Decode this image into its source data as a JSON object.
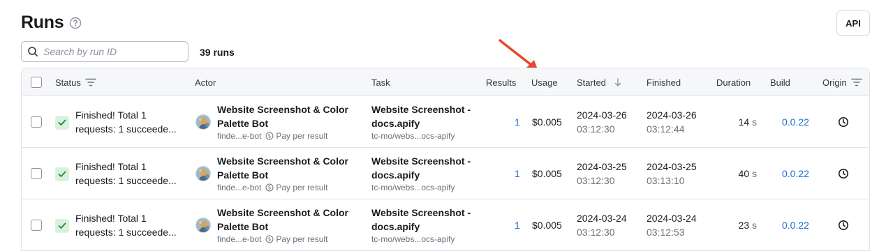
{
  "page": {
    "title": "Runs",
    "api_label": "API",
    "run_count": "39 runs"
  },
  "search": {
    "placeholder": "Search by run ID",
    "value": ""
  },
  "columns": {
    "status": "Status",
    "actor": "Actor",
    "task": "Task",
    "results": "Results",
    "usage": "Usage",
    "started": "Started",
    "finished": "Finished",
    "duration": "Duration",
    "build": "Build",
    "origin": "Origin"
  },
  "rows": [
    {
      "status_line1": "Finished! Total 1",
      "status_line2": "requests: 1 succeede...",
      "actor_line1": "Website Screenshot & Color",
      "actor_line2": "Palette Bot",
      "actor_id": "finde...e-bot",
      "pricing": "Pay per result",
      "task_line1": "Website Screenshot -",
      "task_line2": "docs.apify",
      "task_id": "tc-mo/webs...ocs-apify",
      "results": "1",
      "usage": "$0.005",
      "started_date": "2024-03-26",
      "started_time": "03:12:30",
      "finished_date": "2024-03-26",
      "finished_time": "03:12:44",
      "duration_value": "14",
      "duration_unit": "s",
      "build": "0.0.22"
    },
    {
      "status_line1": "Finished! Total 1",
      "status_line2": "requests: 1 succeede...",
      "actor_line1": "Website Screenshot & Color",
      "actor_line2": "Palette Bot",
      "actor_id": "finde...e-bot",
      "pricing": "Pay per result",
      "task_line1": "Website Screenshot -",
      "task_line2": "docs.apify",
      "task_id": "tc-mo/webs...ocs-apify",
      "results": "1",
      "usage": "$0.005",
      "started_date": "2024-03-25",
      "started_time": "03:12:30",
      "finished_date": "2024-03-25",
      "finished_time": "03:13:10",
      "duration_value": "40",
      "duration_unit": "s",
      "build": "0.0.22"
    },
    {
      "status_line1": "Finished! Total 1",
      "status_line2": "requests: 1 succeede...",
      "actor_line1": "Website Screenshot & Color",
      "actor_line2": "Palette Bot",
      "actor_id": "finde...e-bot",
      "pricing": "Pay per result",
      "task_line1": "Website Screenshot -",
      "task_line2": "docs.apify",
      "task_id": "tc-mo/webs...ocs-apify",
      "results": "1",
      "usage": "$0.005",
      "started_date": "2024-03-24",
      "started_time": "03:12:30",
      "finished_date": "2024-03-24",
      "finished_time": "03:12:53",
      "duration_value": "23",
      "duration_unit": "s",
      "build": "0.0.22"
    }
  ],
  "colors": {
    "link": "#1f6fd6",
    "success_bg": "#d9f2dd",
    "success_check": "#1e8a3a",
    "annotation_arrow": "#e8492a"
  },
  "icons": {
    "help": "help-circle-icon",
    "search": "search-icon",
    "filter": "filter-icon",
    "sort": "arrow-down-icon",
    "status": "check-icon",
    "pricing": "dollar-circle-icon",
    "origin": "clock-icon"
  }
}
